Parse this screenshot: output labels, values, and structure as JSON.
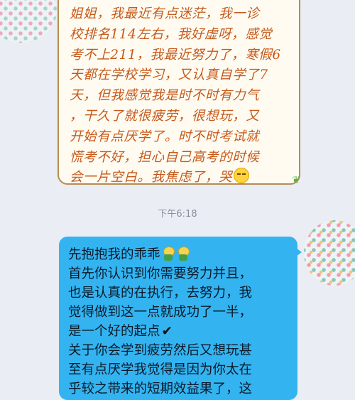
{
  "incoming_message": {
    "lines": [
      "姐姐，我最近有点迷茫，我一诊",
      "校排名114左右，我好虚呀，感觉",
      "考不上211，我最近努力了，寒假6",
      "天都在学校学习，又认真自学了7",
      "天，但我感觉我是时不时有力气",
      "，干久了就很疲劳，很想玩，又",
      "开始有点厌学了。时不时考试就",
      "慌考不好，担心自己高考的时候",
      "会一片空白。我焦虑了，哭"
    ],
    "trailing_emoji": "worried-face-emoji",
    "corner_decoration": "leaf-icon"
  },
  "timestamp": "下午6:18",
  "outgoing_message": {
    "first_line": "先抱抱我的乖乖",
    "first_line_emojis": [
      "hug-sprite-icon",
      "hug-sprite-icon"
    ],
    "body_lines": [
      "首先你认识到你需要努力并且，",
      "也是认真的在执行，去努力，我",
      "觉得做到这一点就成功了一半，",
      "是一个好的起点"
    ],
    "check_mark": "✔",
    "tail_lines": [
      "关于你会学到疲劳然后又想玩甚",
      "至有点厌学我觉得是因为你太在",
      "乎较之带来的短期效益果了，这"
    ]
  },
  "colors": {
    "background": "#eaedf4",
    "incoming_bubble": "#fffbf1",
    "incoming_border": "#b88c4e",
    "incoming_text": "#c55a1c",
    "outgoing_bubble": "#33b4f1",
    "outgoing_text": "#0b1a2a"
  }
}
